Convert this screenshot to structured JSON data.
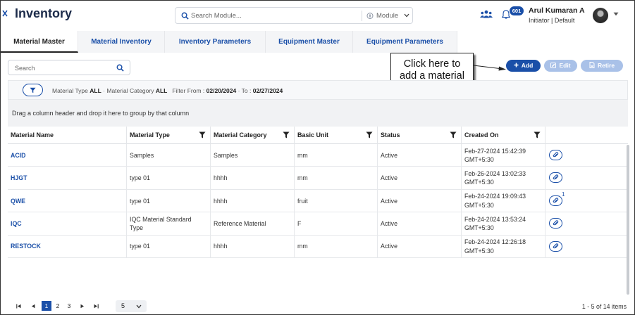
{
  "app": {
    "title": "Inventory"
  },
  "header": {
    "search_placeholder": "Search Module...",
    "module_label": "Module",
    "notification_count": "601",
    "user_name": "Arul Kumaran A",
    "user_role": "Initiator | Default"
  },
  "tabs": [
    {
      "label": "Material Master",
      "active": true
    },
    {
      "label": "Material Inventory",
      "active": false
    },
    {
      "label": "Inventory Parameters",
      "active": false
    },
    {
      "label": "Equipment Master",
      "active": false
    },
    {
      "label": "Equipment Parameters",
      "active": false
    }
  ],
  "toolbar": {
    "search_placeholder": "Search",
    "add_label": "Add",
    "edit_label": "Edit",
    "retire_label": "Retire"
  },
  "callout": {
    "line1": "Click here to",
    "line2": "add a material"
  },
  "filters": {
    "material_type_label": "Material Type",
    "material_type_value": "ALL",
    "material_category_label": "Material Category",
    "material_category_value": "ALL",
    "filter_from_label": "Filter From :",
    "from_date": "02/20/2024",
    "to_label": "To :",
    "to_date": "02/27/2024"
  },
  "group_hint": "Drag a column header and drop it here to group by that column",
  "table": {
    "columns": [
      "Material Name",
      "Material Type",
      "Material Category",
      "Basic Unit",
      "Status",
      "Created On"
    ],
    "rows": [
      {
        "name": "ACID",
        "type": "Samples",
        "category": "Samples",
        "unit": "mm",
        "status": "Active",
        "created_date": "Feb-27-2024 15:42:39",
        "created_tz": "GMT+5:30",
        "attachments": ""
      },
      {
        "name": "HJGT",
        "type": "type 01",
        "category": "hhhh",
        "unit": "mm",
        "status": "Active",
        "created_date": "Feb-26-2024 13:02:33",
        "created_tz": "GMT+5:30",
        "attachments": ""
      },
      {
        "name": "QWE",
        "type": "type 01",
        "category": "hhhh",
        "unit": "fruit",
        "status": "Active",
        "created_date": "Feb-24-2024 19:09:43",
        "created_tz": "GMT+5:30",
        "attachments": "1"
      },
      {
        "name": "IQC",
        "type": "IQC Material Standard Type",
        "category": "Reference Material",
        "unit": "F",
        "status": "Active",
        "created_date": "Feb-24-2024 13:53:24",
        "created_tz": "GMT+5:30",
        "attachments": ""
      },
      {
        "name": "RESTOCK",
        "type": "type 01",
        "category": "hhhh",
        "unit": "mm",
        "status": "Active",
        "created_date": "Feb-24-2024 12:26:18",
        "created_tz": "GMT+5:30",
        "attachments": ""
      }
    ]
  },
  "pager": {
    "pages": [
      "1",
      "2",
      "3"
    ],
    "current_page": "1",
    "page_size": "5",
    "info": "1 - 5 of 14 items"
  },
  "colors": {
    "accent": "#1a4fa8",
    "accent_light": "#a9c1e8",
    "text_dark": "#1c2b4a"
  }
}
